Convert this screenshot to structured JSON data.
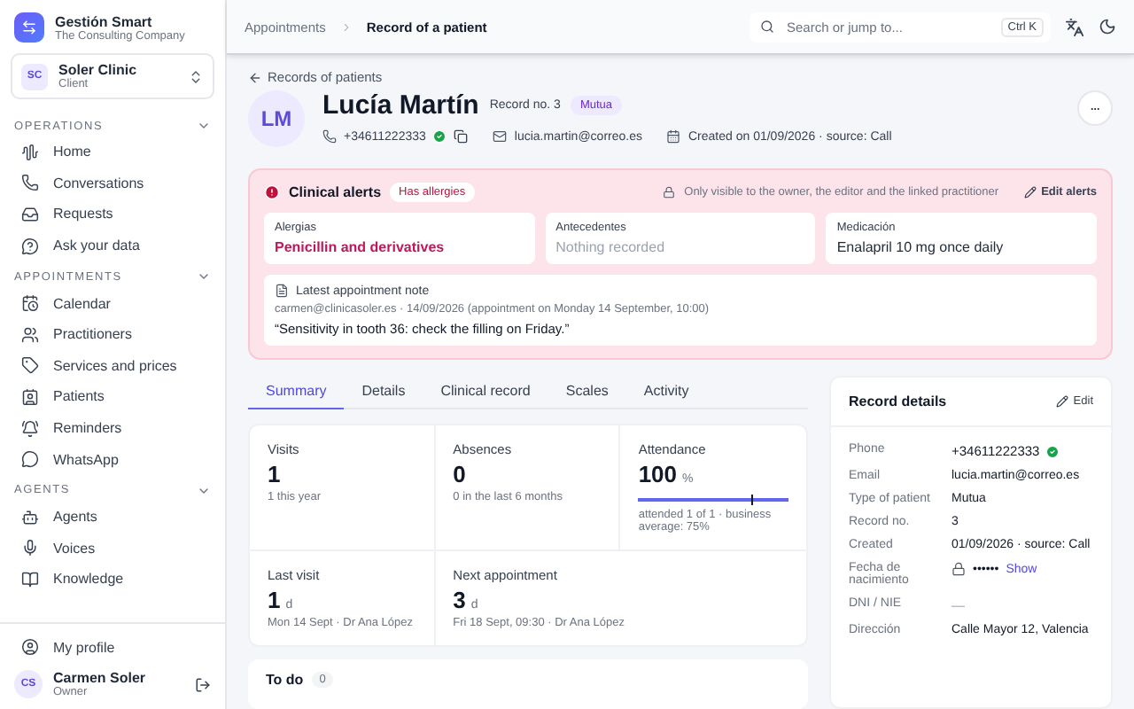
{
  "brand": {
    "name": "Gestión Smart",
    "subtitle": "The Consulting Company"
  },
  "client": {
    "initials": "SC",
    "name": "Soler Clinic",
    "role": "Client"
  },
  "nav_sections": [
    {
      "title": "OPERATIONS",
      "expanded": true,
      "items": [
        {
          "label": "Home",
          "selected": false
        },
        {
          "label": "Conversations",
          "selected": false
        },
        {
          "label": "Requests",
          "selected": false
        },
        {
          "label": "Ask your data",
          "selected": false
        }
      ]
    },
    {
      "title": "APPOINTMENTS",
      "expanded": true,
      "items": [
        {
          "label": "Calendar",
          "selected": false
        },
        {
          "label": "Practitioners",
          "selected": false
        },
        {
          "label": "Services and prices",
          "selected": false
        },
        {
          "label": "Patients",
          "selected": false
        },
        {
          "label": "Reminders",
          "selected": false
        },
        {
          "label": "WhatsApp",
          "selected": false
        }
      ]
    },
    {
      "title": "AGENTS",
      "expanded": true,
      "items": [
        {
          "label": "Agents",
          "selected": false
        },
        {
          "label": "Voices",
          "selected": false
        },
        {
          "label": "Knowledge",
          "selected": false
        }
      ]
    }
  ],
  "profile_link": "My profile",
  "user": {
    "initials": "CS",
    "name": "Carmen Soler",
    "role": "Owner"
  },
  "breadcrumb": [
    "Appointments",
    "Record of a patient"
  ],
  "search": {
    "placeholder": "Search or jump to...",
    "shortcut": "Ctrl K"
  },
  "back_link": "Records of patients",
  "patient": {
    "initials": "LM",
    "name": "Lucía Martín",
    "record": "Record no. 3",
    "tag": "Mutua",
    "phone": "+34611222333",
    "phone_verified": true,
    "email": "lucia.martin@correo.es",
    "created": "Created on 01/09/2026 · source: Call"
  },
  "alerts": {
    "title": "Clinical alerts",
    "badge": "Has allergies",
    "visibility": "Only visible to the owner, the editor and the linked practitioner",
    "edit": "Edit alerts",
    "fields": [
      {
        "label": "Alergias",
        "value": "Penicillin and derivatives",
        "kind": "danger"
      },
      {
        "label": "Antecedentes",
        "value": "Nothing recorded",
        "kind": "empty"
      },
      {
        "label": "Medicación",
        "value": "Enalapril 10 mg once daily",
        "kind": "normal"
      }
    ],
    "note": {
      "title": "Latest appointment note",
      "meta": "carmen@clinicasoler.es · 14/09/2026 (appointment on Monday 14 September, 10:00)",
      "text": "“Sensitivity in tooth 36: check the filling on Friday.”"
    }
  },
  "tabs": [
    {
      "label": "Summary",
      "selected": true
    },
    {
      "label": "Details",
      "selected": false
    },
    {
      "label": "Clinical record",
      "selected": false
    },
    {
      "label": "Scales",
      "selected": false
    },
    {
      "label": "Activity",
      "selected": false
    }
  ],
  "stats": [
    {
      "label": "Visits",
      "value": "1",
      "note": "1 this year",
      "kind": "plain"
    },
    {
      "label": "Absences",
      "value": "0",
      "note": "0 in the last 6 months",
      "kind": "plain"
    },
    {
      "label": "Attendance",
      "value": "100",
      "unit": "%",
      "note": "attended 1 of 1 · business average: 75%",
      "kind": "meter",
      "level": 1
    },
    {
      "label": "Last visit",
      "value": "1",
      "unit": "d",
      "note": "Mon 14 Sept · Dr Ana López",
      "kind": "plain"
    },
    {
      "label": "Next appointment",
      "value": "3",
      "unit": "d",
      "note": "Fri 18 Sept, 09:30 · Dr Ana López",
      "kind": "plain"
    }
  ],
  "todo": {
    "title": "To do",
    "count": "0"
  },
  "record_details": {
    "title": "Record details",
    "edit": "Edit",
    "rows": [
      {
        "label": "Phone",
        "value": "+34611222333",
        "kind": "verified"
      },
      {
        "label": "Email",
        "value": "lucia.martin@correo.es",
        "kind": "text"
      },
      {
        "label": "Type of patient",
        "value": "Mutua",
        "kind": "text"
      },
      {
        "label": "Record no.",
        "value": "3",
        "kind": "text"
      },
      {
        "label": "Created",
        "value": "01/09/2026 · source: Call",
        "kind": "text"
      },
      {
        "label": "Fecha de nacimiento",
        "value": "••••••",
        "action": "Show",
        "kind": "hidden"
      },
      {
        "label": "DNI / NIE",
        "value": "—",
        "kind": "muted"
      },
      {
        "label": "Dirección",
        "value": "Calle Mayor 12, Valencia",
        "kind": "text"
      }
    ]
  }
}
